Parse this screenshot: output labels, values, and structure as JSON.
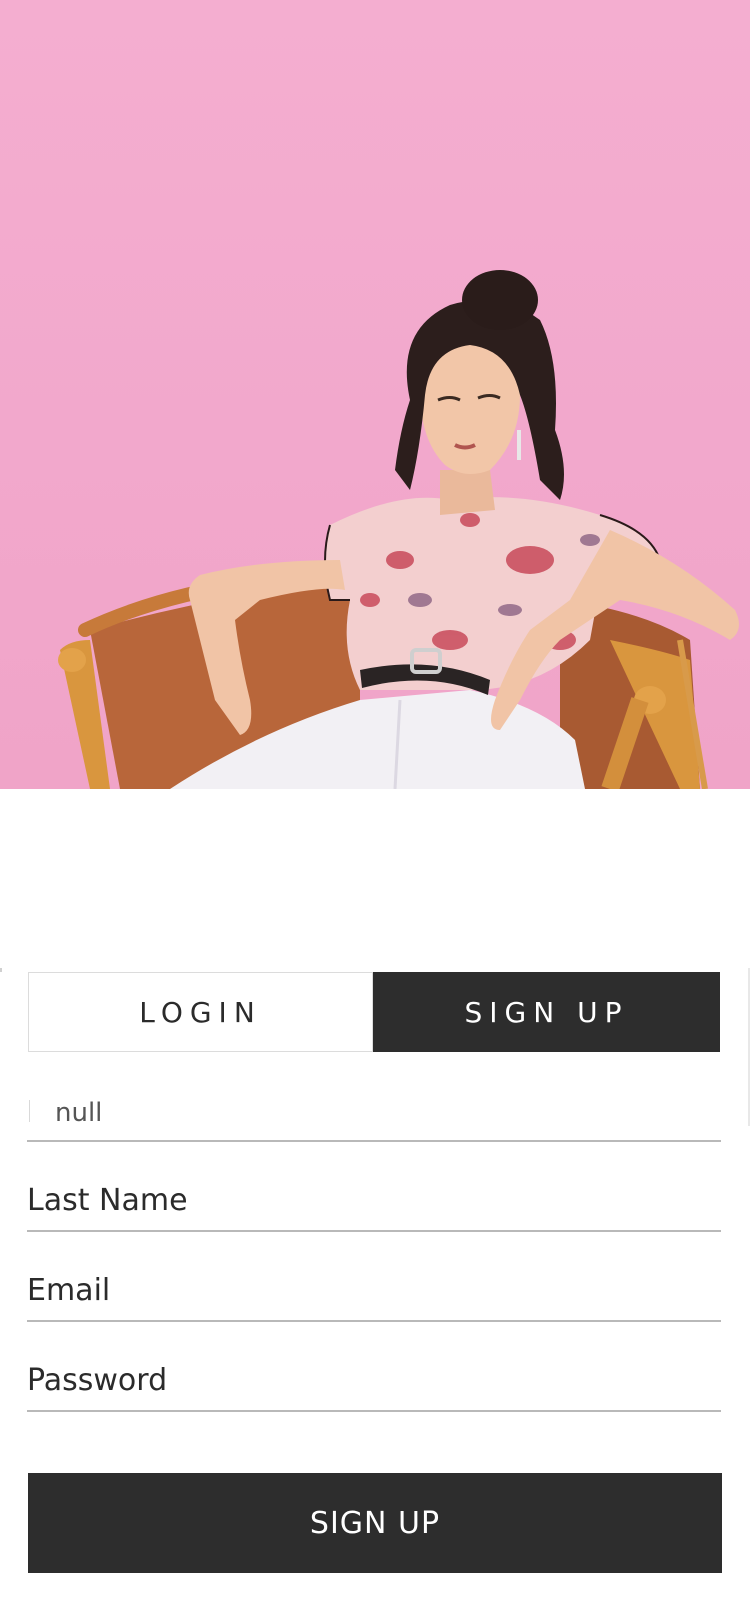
{
  "colors": {
    "accent_dark": "#2d2d2d",
    "background": "#ffffff",
    "hero_pink": "#f2a8cc",
    "underline": "#b9b9b9"
  },
  "hero": {
    "image": "woman-seated-in-leather-chair-pink-backdrop"
  },
  "tabs": {
    "login_label": "LOGIN",
    "signup_label": "SIGN UP",
    "active": "signup"
  },
  "form": {
    "first_name_value": "null",
    "last_name_placeholder": "Last Name",
    "email_placeholder": "Email",
    "password_placeholder": "Password"
  },
  "submit": {
    "label": "SIGN UP"
  }
}
